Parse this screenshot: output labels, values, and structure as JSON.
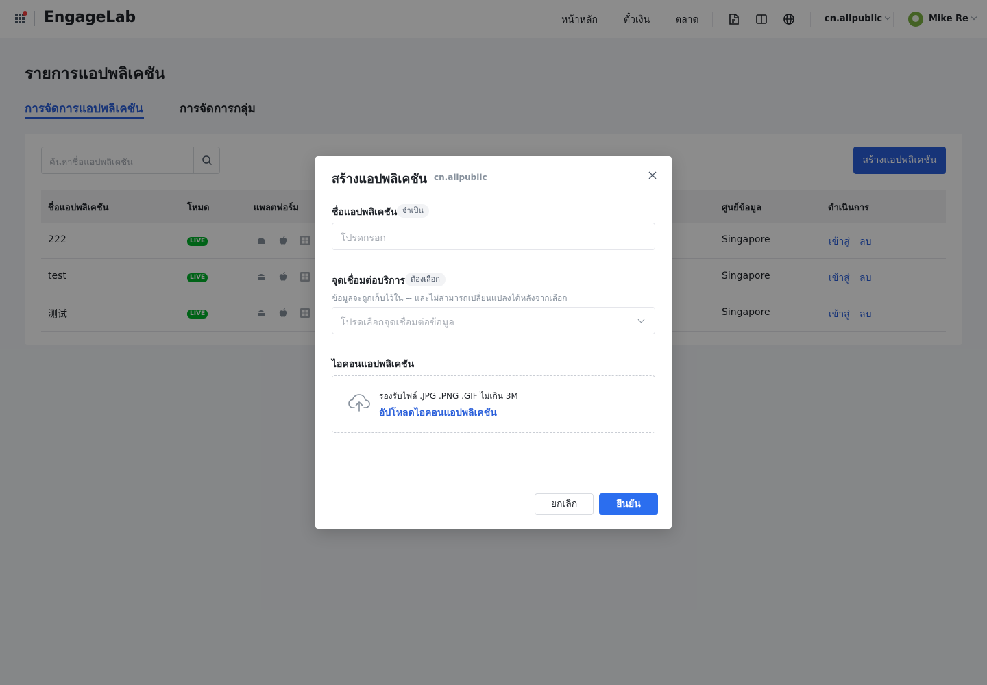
{
  "header": {
    "brand": "EngageLab",
    "nav": [
      "หน้าหลัก",
      "ตั๋วเงิน",
      "ตลาด"
    ],
    "workspace": "cn.allpublic",
    "user": "Mike Re"
  },
  "page": {
    "title": "รายการแอปพลิเคชัน",
    "tabs": [
      "การจัดการแอปพลิเคชัน",
      "การจัดการกลุ่ม"
    ]
  },
  "toolbar": {
    "search_placeholder": "ค้นหาชื่อแอปพลิเคชัน",
    "create_label": "สร้างแอปพลิเคชัน"
  },
  "table": {
    "columns": [
      "ชื่อแอปพลิเคชัน",
      "โหมด",
      "แพลตฟอร์ม",
      "ศูนย์ข้อมูล",
      "ดำเนินการ"
    ],
    "rows": [
      {
        "name": "222",
        "mode": "LIVE",
        "datacenter": "Singapore",
        "enter": "เข้าสู่",
        "delete": "ลบ"
      },
      {
        "name": "test",
        "mode": "LIVE",
        "datacenter": "Singapore",
        "enter": "เข้าสู่",
        "delete": "ลบ"
      },
      {
        "name": "测试",
        "mode": "LIVE",
        "datacenter": "Singapore",
        "enter": "เข้าสู่",
        "delete": "ลบ"
      }
    ]
  },
  "modal": {
    "title": "สร้างแอปพลิเคชัน",
    "workspace": "cn.allpublic",
    "name_label": "ชื่อแอปพลิเคชัน",
    "name_tag": "จำเป็น",
    "name_placeholder": "โปรดกรอก",
    "endpoint_label": "จุดเชื่อมต่อบริการ",
    "endpoint_tag": "ต้องเลือก",
    "endpoint_hint": "ข้อมูลจะถูกเก็บไว้ใน -- และไม่สามารถเปลี่ยนแปลงได้หลังจากเลือก",
    "endpoint_placeholder": "โปรดเลือกจุดเชื่อมต่อข้อมูล",
    "icon_label": "ไอคอนแอปพลิเคชัน",
    "upload_note": "รองรับไฟล์ .JPG .PNG .GIF ไม่เกิน 3M",
    "upload_link": "อัปโหลดไอคอนแอปพลิเคชัน",
    "cancel_label": "ยกเลิก",
    "confirm_label": "ยืนยัน"
  },
  "colors": {
    "accent": "#2a5fda",
    "primary_button": "#2b6eef",
    "live_badge": "#00b42a"
  },
  "icons": [
    "apps-grid-icon",
    "document-icon",
    "book-icon",
    "globe-icon",
    "search-icon",
    "android-icon",
    "apple-icon",
    "harmony-icon",
    "close-icon",
    "cloud-upload-icon"
  ]
}
